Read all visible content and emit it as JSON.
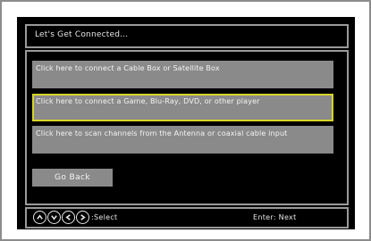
{
  "header": {
    "title": "Let's Get Connected..."
  },
  "options": [
    {
      "label": "Click here to connect a Cable Box or Satellite Box",
      "selected": false
    },
    {
      "label": "Click here to connect a Game, Blu-Ray, DVD, or other player",
      "selected": true
    },
    {
      "label": "Click here to scan channels from the Antenna or coaxial cable input",
      "selected": false
    }
  ],
  "go_back_label": "Go Back",
  "footer": {
    "nav_icons": [
      "arrow-up-icon",
      "arrow-down-icon",
      "arrow-left-icon",
      "arrow-right-icon"
    ],
    "select_label": ":Select",
    "enter_label": "Enter: Next"
  },
  "colors": {
    "background": "#000000",
    "option_fill": "#8a8a8a",
    "selection_highlight": "#d7d42a",
    "frame_border": "#9a9a9a",
    "text": "#f4f4f4"
  }
}
